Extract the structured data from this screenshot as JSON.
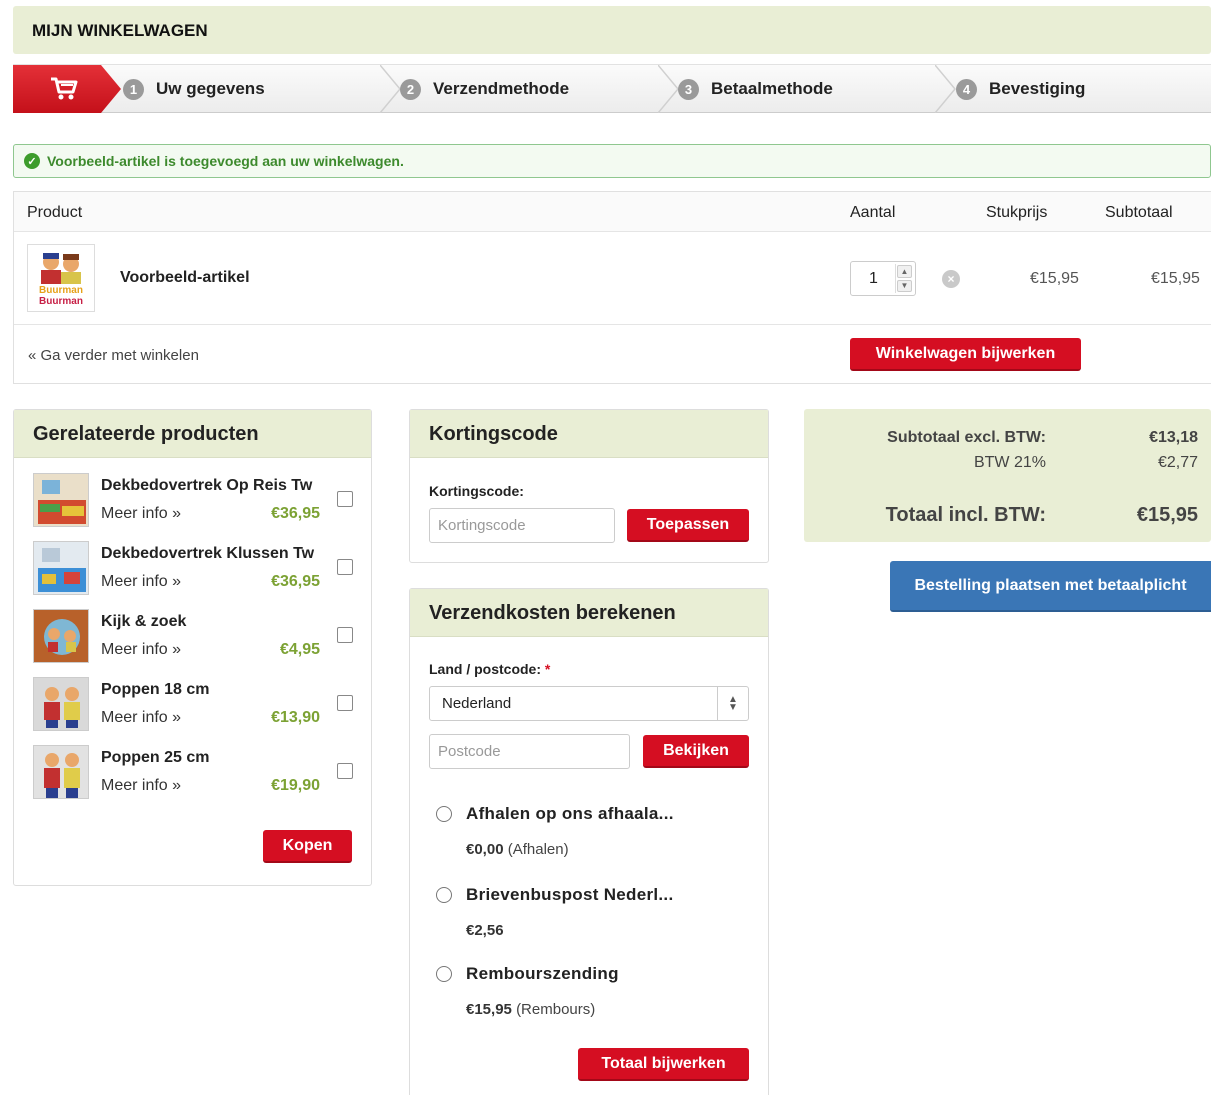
{
  "page_title": "MIJN WINKELWAGEN",
  "steps": [
    {
      "num": "1",
      "label": "Uw gegevens"
    },
    {
      "num": "2",
      "label": "Verzendmethode"
    },
    {
      "num": "3",
      "label": "Betaalmethode"
    },
    {
      "num": "4",
      "label": "Bevestiging"
    }
  ],
  "alert": "Voorbeeld-artikel is toegevoegd aan uw winkelwagen.",
  "cart": {
    "headers": {
      "product": "Product",
      "quantity": "Aantal",
      "unit_price": "Stukprijs",
      "subtotal": "Subtotaal"
    },
    "item": {
      "name": "Voorbeeld-artikel",
      "image_text": "Buurman Buurman",
      "quantity": "1",
      "unit_price": "€15,95",
      "subtotal": "€15,95"
    },
    "continue": "« Ga verder met winkelen",
    "update_button": "Winkelwagen bijwerken"
  },
  "related": {
    "title": "Gerelateerde producten",
    "items": [
      {
        "name": "Dekbedovertrek Op Reis Tw",
        "more": "Meer info »",
        "price": "€36,95"
      },
      {
        "name": "Dekbedovertrek Klussen Tw",
        "more": "Meer info »",
        "price": "€36,95"
      },
      {
        "name": "Kijk & zoek",
        "more": "Meer info »",
        "price": "€4,95"
      },
      {
        "name": "Poppen 18 cm",
        "more": "Meer info »",
        "price": "€13,90"
      },
      {
        "name": "Poppen 25 cm",
        "more": "Meer info »",
        "price": "€19,90"
      }
    ],
    "buy_button": "Kopen"
  },
  "discount": {
    "title": "Kortingscode",
    "label": "Kortingscode:",
    "placeholder": "Kortingscode",
    "apply_button": "Toepassen"
  },
  "shipping": {
    "title": "Verzendkosten berekenen",
    "label": "Land / postcode:",
    "required_mark": "*",
    "country": "Nederland",
    "postcode_placeholder": "Postcode",
    "view_button": "Bekijken",
    "options": [
      {
        "label": "Afhalen op ons afhaala...",
        "price": "€0,00",
        "note": "(Afhalen)"
      },
      {
        "label": "Brievenbuspost Nederl...",
        "price": "€2,56",
        "note": ""
      },
      {
        "label": "Rembourszending",
        "price": "€15,95",
        "note": "(Rembours)"
      }
    ],
    "update_button": "Totaal bijwerken"
  },
  "totals": {
    "subtotal_label": "Subtotaal excl. BTW:",
    "subtotal_value": "€13,18",
    "vat_label": "BTW 21%",
    "vat_value": "€2,77",
    "total_label": "Totaal incl. BTW:",
    "total_value": "€15,95"
  },
  "checkout_button": "Bestelling plaatsen met betaalplicht",
  "colors": {
    "brand_red": "#d50e22",
    "panel_header": "#e9eed5",
    "price_green": "#7ca234",
    "checkout_blue": "#3a76b6"
  }
}
